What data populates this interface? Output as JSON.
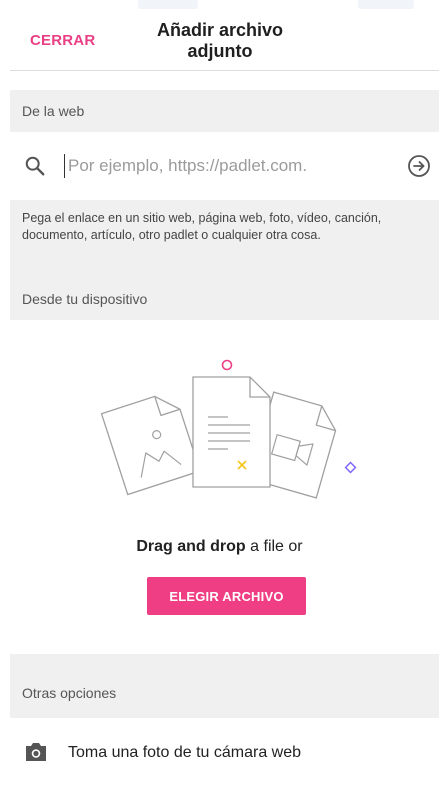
{
  "header": {
    "close_label": "CERRAR",
    "title": "Añadir archivo adjunto"
  },
  "web": {
    "section_label": "De la web",
    "search_placeholder": "Por ejemplo, https://padlet.com.",
    "search_value": "",
    "hint": "Pega el enlace en un sitio web, página web, foto, vídeo, canción, documento, artículo, otro padlet o cualquier otra cosa."
  },
  "device": {
    "section_label": "Desde tu dispositivo",
    "drag_bold": "Drag and drop",
    "drag_rest": " a file or",
    "choose_label": "ELEGIR ARCHIVO"
  },
  "other": {
    "section_label": "Otras opciones",
    "webcam_label": "Toma una foto de tu cámara web"
  },
  "colors": {
    "accent": "#ea3f84",
    "button_bg": "#ef3e83",
    "section_bg": "#f0f0f0",
    "deco_yellow": "#f5c518",
    "deco_purple": "#7b61ff"
  },
  "icons": {
    "search": "search-icon",
    "go": "arrow-circle-right-icon",
    "camera": "camera-icon"
  }
}
